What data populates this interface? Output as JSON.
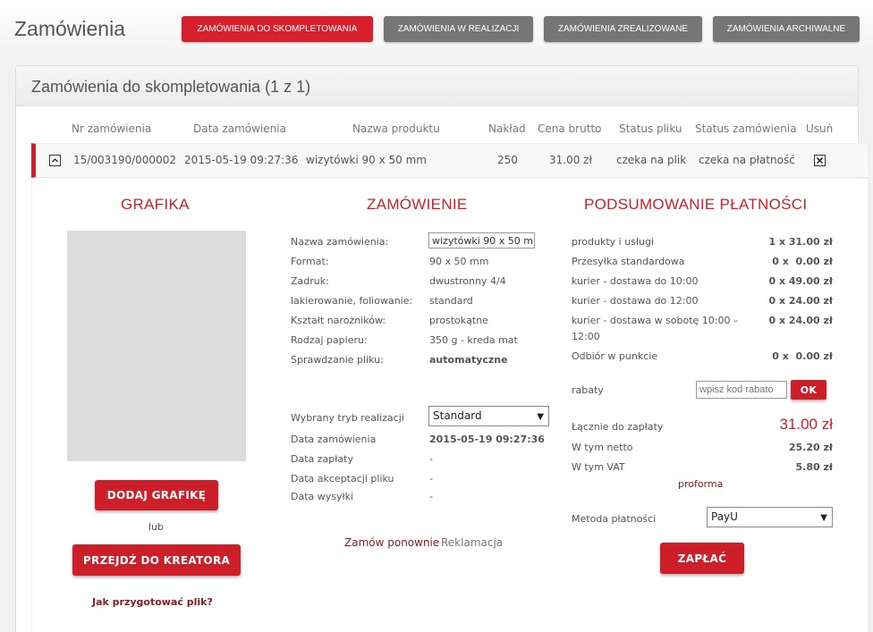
{
  "header": {
    "title": "Zamówienia",
    "tabs": [
      {
        "label": "ZAMÓWIENIA DO SKOMPLETOWANIA",
        "active": true
      },
      {
        "label": "ZAMÓWIENIA W REALIZACJI",
        "active": false
      },
      {
        "label": "ZAMÓWIENIA ZREALIZOWANE",
        "active": false
      },
      {
        "label": "ZAMÓWIENIA ARCHIWALNE",
        "active": false
      }
    ]
  },
  "panel": {
    "title": "Zamówienia do skompletowania (1 z 1)"
  },
  "table": {
    "columns": [
      "Nr zamówienia",
      "Data zamówienia",
      "Nazwa produktu",
      "Nakład",
      "Cena brutto",
      "Status pliku",
      "Status zamówienia",
      "Usuń"
    ],
    "row": {
      "expand_icon": "chevron-up-icon",
      "number": "15/003190/000002",
      "date": "2015-05-19 09:27:36",
      "product": "wizytówki 90 x 50 mm",
      "quantity": "250",
      "price": "31.00 zł",
      "file_status": "czeka na plik",
      "order_status": "czeka na płatność",
      "delete_icon": "close-box-icon"
    }
  },
  "graphics": {
    "title": "GRAFIKA",
    "add_button": "DODAJ GRAFIKĘ",
    "or": "lub",
    "creator_button": "PRZEJDŹ DO KREATORA",
    "help_link": "Jak przygotować plik?"
  },
  "order": {
    "title": "ZAMÓWIENIE",
    "name_label": "Nazwa zamówienia:",
    "name_value": "wizytówki 90 x 50 mm",
    "fields": [
      {
        "label": "Format:",
        "value": "90 x 50 mm"
      },
      {
        "label": "Zadruk:",
        "value": "dwustronny 4/4"
      },
      {
        "label": "lakierowanie, foliowanie:",
        "value": "standard"
      },
      {
        "label": "Kształt narożników:",
        "value": "prostokątne"
      },
      {
        "label": "Rodzaj papieru:",
        "value": "350 g - kreda mat"
      },
      {
        "label": "Sprawdzanie pliku:",
        "value": "automatyczne"
      }
    ],
    "mode_label": "Wybrany tryb realizacji",
    "mode_value": "Standard",
    "dates": [
      {
        "label": "Data zamówienia",
        "value": "2015-05-19 09:27:36"
      },
      {
        "label": "Data zapłaty",
        "value": "-"
      },
      {
        "label": "Data akceptacji pliku",
        "value": "-"
      },
      {
        "label": "Data wysyłki",
        "value": "-"
      }
    ],
    "reorder_link": "Zamów ponownie",
    "complaint_link": "Reklamacja"
  },
  "payment": {
    "title": "PODSUMOWANIE PŁATNOŚCI",
    "items": [
      {
        "label": "produkty i usługi",
        "value": "1 x 31.00 zł"
      },
      {
        "label": "Przesyłka standardowa",
        "value": "0 x  0.00 zł"
      },
      {
        "label": "kurier - dostawa do 10:00",
        "value": "0 x 49.00 zł"
      },
      {
        "label": "kurier - dostawa do 12:00",
        "value": "0 x 24.00 zł"
      },
      {
        "label": "kurier - dostawa w sobotę 10:00 –",
        "label2": "12:00",
        "value": "0 x 24.00 zł"
      },
      {
        "label": "Odbiór w punkcie",
        "value": "0 x  0.00 zł"
      }
    ],
    "discount_label": "rabaty",
    "discount_placeholder": "wpisz kod rabato",
    "ok_button": "OK",
    "total_label": "Łącznie do zapłaty",
    "total_value": "31.00 zł",
    "net_label": "W tym netto",
    "net_value": "25.20 zł",
    "vat_label": "W tym VAT",
    "vat_value": "5.80 zł",
    "proforma_link": "proforma",
    "method_label": "Metoda płatności",
    "method_value": "PayU",
    "pay_button": "ZAPŁAĆ"
  },
  "colors": {
    "accent": "#cd1f2a",
    "tab_inactive": "#767676",
    "link": "#8b1a22"
  }
}
